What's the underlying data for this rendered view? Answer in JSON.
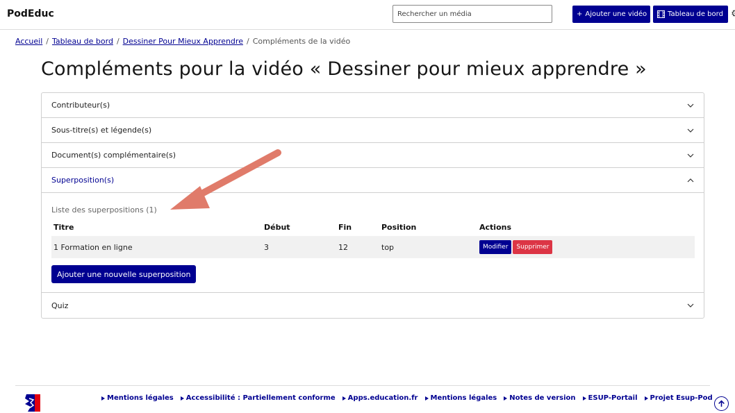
{
  "header": {
    "brand": "PodEduc",
    "search_placeholder": "Rechercher un média",
    "add_video_label": "Ajouter une vidéo",
    "dashboard_label": "Tableau de bord"
  },
  "breadcrumb": {
    "home": "Accueil",
    "dashboard": "Tableau de bord",
    "video": "Dessiner Pour Mieux Apprendre",
    "current": "Compléments de la vidéo"
  },
  "page": {
    "title": "Compléments pour la vidéo « Dessiner pour mieux apprendre »"
  },
  "accordion": {
    "sections": [
      {
        "label": "Contributeur(s)",
        "expanded": false
      },
      {
        "label": "Sous-titre(s) et légende(s)",
        "expanded": false
      },
      {
        "label": "Document(s) complémentaire(s)",
        "expanded": false
      },
      {
        "label": "Superposition(s)",
        "expanded": true
      },
      {
        "label": "Quiz",
        "expanded": false
      }
    ]
  },
  "overlays": {
    "list_title": "Liste des superpositions (1)",
    "columns": [
      "Titre",
      "Début",
      "Fin",
      "Position",
      "Actions"
    ],
    "rows": [
      {
        "title": "1 Formation en ligne",
        "start": "3",
        "end": "12",
        "position": "top"
      }
    ],
    "edit_label": "Modifier",
    "delete_label": "Supprimer",
    "add_label": "Ajouter une nouvelle superposition"
  },
  "footer": {
    "links": [
      "Mentions légales",
      "Accessibilité : Partiellement conforme",
      "Apps.education.fr",
      "Mentions légales",
      "Notes de version",
      "ESUP-Portail",
      "Projet Esup-Pod"
    ]
  },
  "colors": {
    "primary": "#000091",
    "danger": "#dc3545",
    "arrow": "#e07b6a"
  },
  "icons": {
    "add": "plus-icon",
    "dashboard": "film-icon",
    "settings": "gear-icon",
    "chevron_down": "chevron-down-icon",
    "chevron_up": "chevron-up-icon",
    "scroll_top": "arrow-up-circle-icon"
  }
}
